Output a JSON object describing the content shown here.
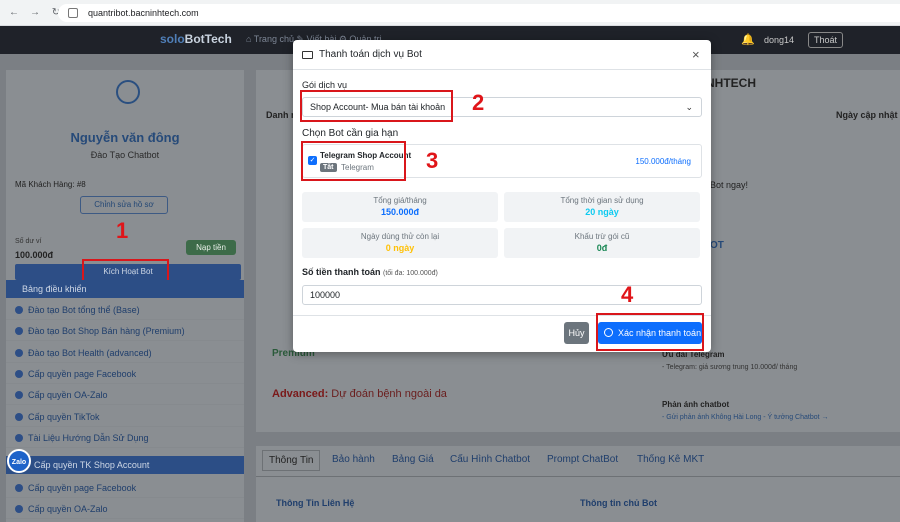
{
  "browser": {
    "url": "quantribot.bacninhtech.com"
  },
  "navbar": {
    "brand_a": "solo",
    "brand_b": "BotTech",
    "links": "⌂ Trang chủ   ✎ Viết bài   ⚙ Quản trị",
    "user": "dong14",
    "logout": "Thoát"
  },
  "profile": {
    "name": "Nguyễn văn đông",
    "subtitle": "Đào Tạo Chatbot",
    "customer_id": "Mã Khách Hàng: #8",
    "edit_label": "Chỉnh sửa hồ sơ",
    "balance_label": "Số dư ví",
    "balance_value": "100.000đ",
    "topup_label": "Nạp tiền",
    "activate_label": "Kích Hoạt Bot"
  },
  "sidebar": {
    "head1": "Bảng điều khiển",
    "items": [
      "Đào tạo Bot tổng thể (Base)",
      "Đào tạo Bot Shop Bán hàng (Premium)",
      "Đào tạo Bot Health (advanced)",
      "Cấp quyền page Facebook",
      "Cấp quyền OA-Zalo",
      "Cấp quyền TikTok",
      "Tài Liệu Hướng Dẫn Sử Dụng"
    ],
    "head2": "Cấp quyền TK Shop Account",
    "items2": [
      "Cấp quyền page Facebook",
      "Cấp quyền OA-Zalo"
    ],
    "zalo": "Zalo"
  },
  "annotations": {
    "n1": "1",
    "n2": "2",
    "n3": "3",
    "n4": "4"
  },
  "background": {
    "title": "NHTECH",
    "col1": "Danh m",
    "col2": "Ngày cập nhật",
    "text1": "Bot ngay!",
    "bot": "OT",
    "premium": "Premium",
    "advanced_b": "Advanced:",
    "advanced_t": " Dự đoán bệnh ngoài da",
    "tele_title": "Ưu đãi Telegram",
    "tele_sub": "- Telegram: giá sương trung 10.000đ/ tháng",
    "fb_title": "Phản ánh chatbot",
    "fb_sub": "- Gửi phản ánh Không Hài Long - Ý tưởng Chatbot →"
  },
  "tabs": [
    "Thông Tin",
    "Bảo hành",
    "Bảng Giá",
    "Cấu Hình Chatbot",
    "Prompt ChatBot",
    "Thống Kê MKT"
  ],
  "tabs_sections": {
    "contact": "Thông Tin Liên Hệ",
    "botinfo": "Thông tin chủ Bot"
  },
  "modal": {
    "title": "Thanh toán dịch vụ Bot",
    "close": "×",
    "package_label": "Gói dịch vụ",
    "package_value": "Shop Account- Mua bán tài khoản",
    "choose_label": "Chọn Bot cần gia hạn",
    "bot_name": "Telegram Shop Account",
    "bot_badge": "Tắt",
    "bot_platform": "Telegram",
    "bot_price": "150.000đ/tháng",
    "stats": [
      {
        "label": "Tổng giá/tháng",
        "value": "150.000đ",
        "color": "#0d6efd"
      },
      {
        "label": "Tổng thời gian sử dụng",
        "value": "20 ngày",
        "color": "#0dcaf0"
      },
      {
        "label": "Ngày dùng thử còn lại",
        "value": "0 ngày",
        "color": "#ffc107"
      },
      {
        "label": "Khấu trừ gói cũ",
        "value": "0đ",
        "color": "#198754"
      }
    ],
    "amount_label": "Số tiền thanh toán",
    "amount_hint": "(tối đa: 100.000đ)",
    "amount_value": "100000",
    "cancel": "Hủy",
    "confirm": "Xác nhận thanh toán"
  },
  "colors": {
    "primary": "#0d6efd",
    "annotation_red": "#d9161b"
  }
}
